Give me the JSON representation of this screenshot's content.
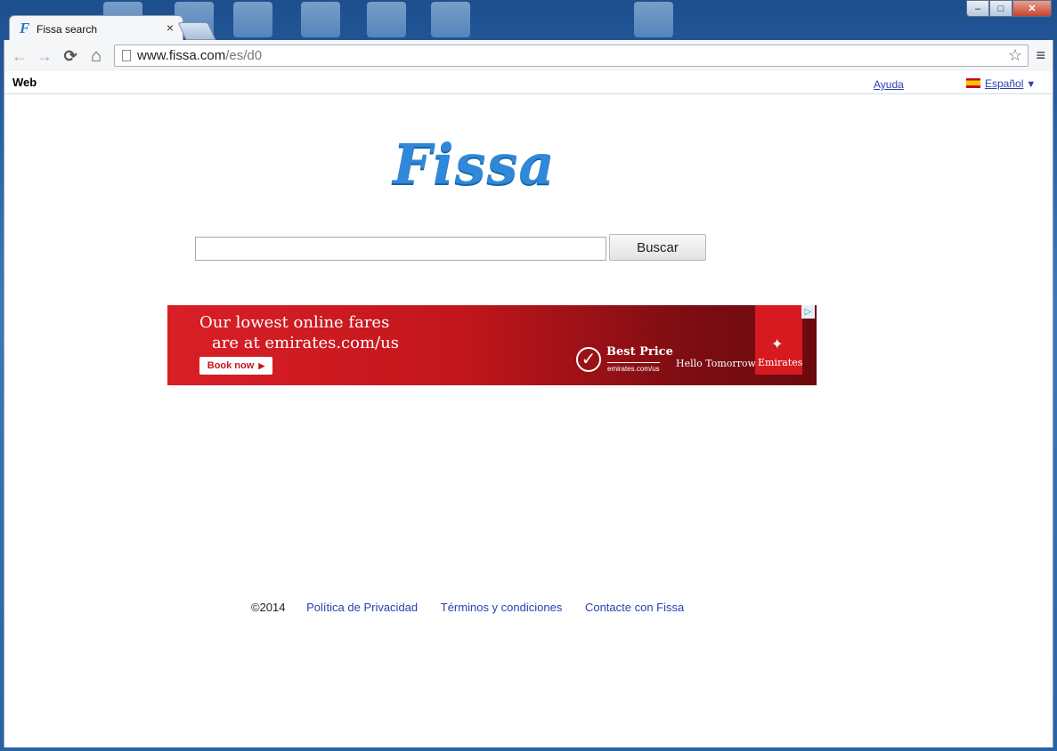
{
  "browser": {
    "tab": {
      "title": "Fissa search",
      "favicon": "F",
      "close_label": "×"
    },
    "window_controls": {
      "minimize": "–",
      "maximize": "□",
      "close": "✕"
    },
    "nav": {
      "back_icon": "←",
      "forward_icon": "→",
      "reload_icon": "⟳",
      "home_icon": "⌂"
    },
    "url": {
      "host": "www.fissa.com",
      "path": "/es/d0"
    },
    "star_icon": "☆",
    "menu_icon": "≡"
  },
  "topbar": {
    "web_label": "Web",
    "help_label": "Ayuda",
    "language_label": "Español",
    "language_arrow": "▼"
  },
  "logo": {
    "text": "Fissa"
  },
  "search": {
    "value": "",
    "button_label": "Buscar"
  },
  "ad": {
    "headline_line1": "Our lowest online fares",
    "headline_line2": "are at emirates.com/us",
    "cta_label": "Book now",
    "cta_arrow": "▶",
    "check_icon": "✓",
    "best_price_label": "Best Price",
    "best_price_url": "emirates.com/us",
    "tagline": "Hello Tomorrow",
    "brand": "Emirates",
    "choices_icon": "▷"
  },
  "footer": {
    "copyright": "©2014",
    "links": [
      "Política de Privacidad",
      "Términos y condiciones",
      "Contacte con Fissa"
    ]
  }
}
